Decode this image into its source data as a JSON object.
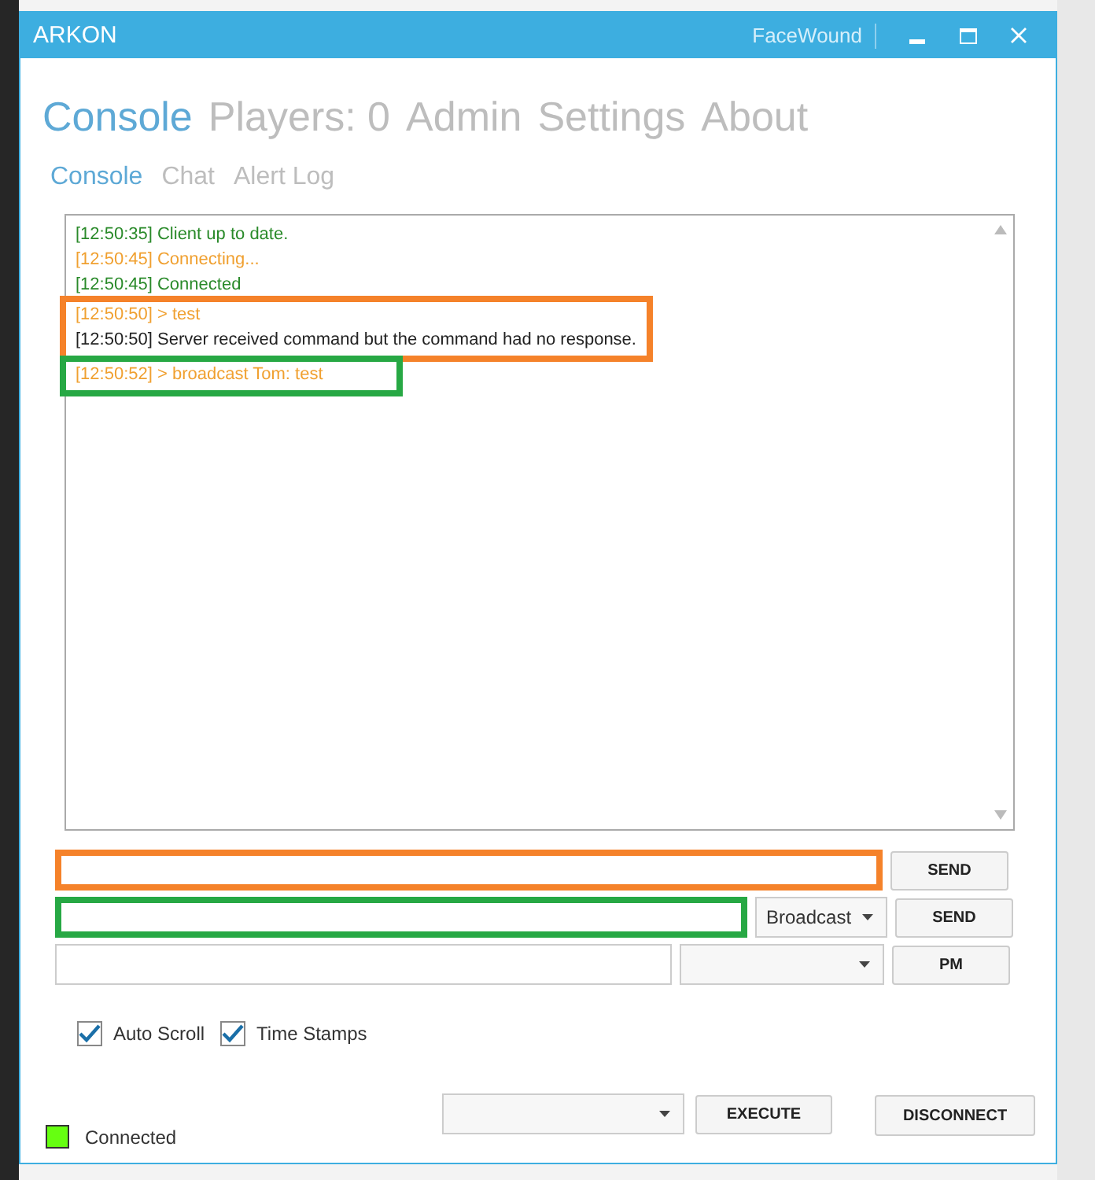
{
  "window": {
    "title": "ARKON",
    "user": "FaceWound"
  },
  "main_tabs": [
    {
      "label": "Console",
      "selected": true
    },
    {
      "label": "Players: 0",
      "selected": false
    },
    {
      "label": "Admin",
      "selected": false
    },
    {
      "label": "Settings",
      "selected": false
    },
    {
      "label": "About",
      "selected": false
    }
  ],
  "sub_tabs": [
    {
      "label": "Console",
      "selected": true
    },
    {
      "label": "Chat",
      "selected": false
    },
    {
      "label": "Alert Log",
      "selected": false
    }
  ],
  "log_groups": [
    {
      "lines": [
        {
          "text": "[12:50:35] Client up to date.",
          "color": "#2a8a2a"
        },
        {
          "text": "[12:50:45] Connecting...",
          "color": "#f0a030"
        },
        {
          "text": "[12:50:45] Connected",
          "color": "#2a8a2a"
        }
      ]
    },
    {
      "color": "#f5822a",
      "lines": [
        {
          "text": "[12:50:50] > test",
          "color": "#f0a030"
        },
        {
          "text": "[12:50:50] Server received command but the command had no response.",
          "color": "#222222"
        }
      ]
    },
    {
      "color": "#27a844",
      "lines": [
        {
          "text": "[12:50:52] > broadcast Tom: test",
          "color": "#f0a030"
        }
      ]
    }
  ],
  "input_rows": [
    {
      "kind": "plain",
      "color": "#f5822a",
      "button": "SEND"
    },
    {
      "kind": "dropdown",
      "color": "#27a844",
      "dropdown": "Broadcast",
      "button": "SEND"
    },
    {
      "kind": "dropdown",
      "dropdown": "",
      "button": "PM"
    }
  ],
  "options": [
    {
      "label": "Auto Scroll",
      "checked": true
    },
    {
      "label": "Time Stamps",
      "checked": true
    }
  ],
  "status": {
    "label": "Connected",
    "color": "#66ff11"
  },
  "execute_button": "EXECUTE",
  "disconnect_button": "DISCONNECT"
}
